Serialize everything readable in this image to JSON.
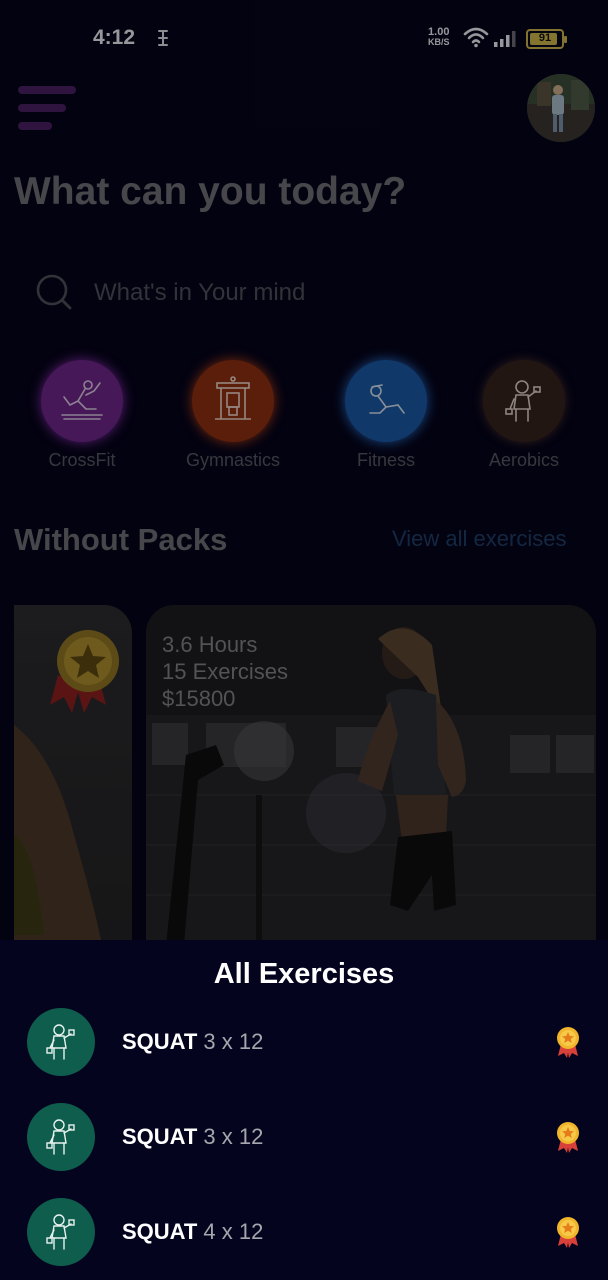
{
  "status_bar": {
    "time": "4:12",
    "speed_value": "1.00",
    "speed_unit": "KB/S",
    "battery": "91",
    "battery_level": 0.91
  },
  "header": {
    "headline": "What can you today?"
  },
  "search": {
    "placeholder": "What's in Your mind"
  },
  "categories": [
    {
      "label": "CrossFit",
      "icon": "crossfit-icon",
      "color": "#7b2a9a"
    },
    {
      "label": "Gymnastics",
      "icon": "gym-machine-icon",
      "color": "#9b3412"
    },
    {
      "label": "Fitness",
      "icon": "situp-icon",
      "color": "#1d5fae"
    },
    {
      "label": "Aerobics",
      "icon": "dumbbell-woman-icon",
      "color": "#3a2722"
    }
  ],
  "packs": {
    "title": "Without Packs",
    "view_all": "View all exercises",
    "featured": {
      "hours": "3.6 Hours",
      "exercises": "15 Exercises",
      "price": "$15800"
    }
  },
  "sheet": {
    "title": "All Exercises",
    "items": [
      {
        "name": "SQUAT",
        "reps": "3 x 12"
      },
      {
        "name": "SQUAT",
        "reps": "3 x 12"
      },
      {
        "name": "SQUAT",
        "reps": "4 x 12"
      }
    ]
  },
  "colors": {
    "background": "#05041a",
    "accent_link": "#1f3d66",
    "exercise_thumb": "#0e5d4d"
  }
}
